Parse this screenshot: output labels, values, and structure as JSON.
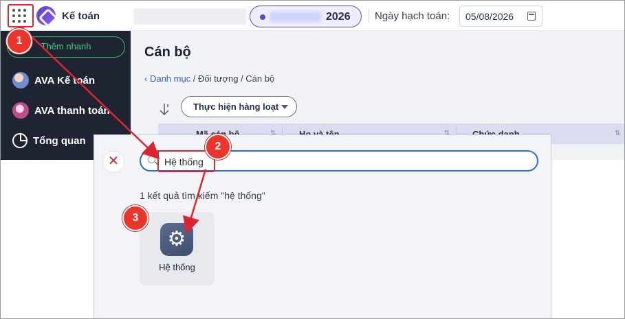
{
  "topbar": {
    "app_name": "Kế toán",
    "fiscal_year": "2026",
    "date_label": "Ngày hạch toán:",
    "date_value": "05/08/2026"
  },
  "sidebar": {
    "quick_add": "Thêm nhanh",
    "items": [
      {
        "label": "AVA Kế toán"
      },
      {
        "label": "AVA thanh toán"
      },
      {
        "label": "Tổng quan"
      }
    ]
  },
  "main": {
    "title": "Cán bộ",
    "breadcrumb": {
      "back": "Danh mục",
      "rest": " / Đối tượng / Cán bộ"
    },
    "bulk_action": "Thực hiện hàng loạt",
    "table_headers": [
      "Mã cán bộ",
      "Họ và tên",
      "Chức danh"
    ]
  },
  "search_panel": {
    "query": "Hệ thống",
    "result_text": "1 kết quả tìm kiếm \"hệ thống\"",
    "results": [
      {
        "label": "Hệ thống",
        "icon": "gear-icon"
      }
    ]
  },
  "annotations": {
    "steps": [
      "1",
      "2",
      "3"
    ],
    "color": "#e0242f"
  }
}
